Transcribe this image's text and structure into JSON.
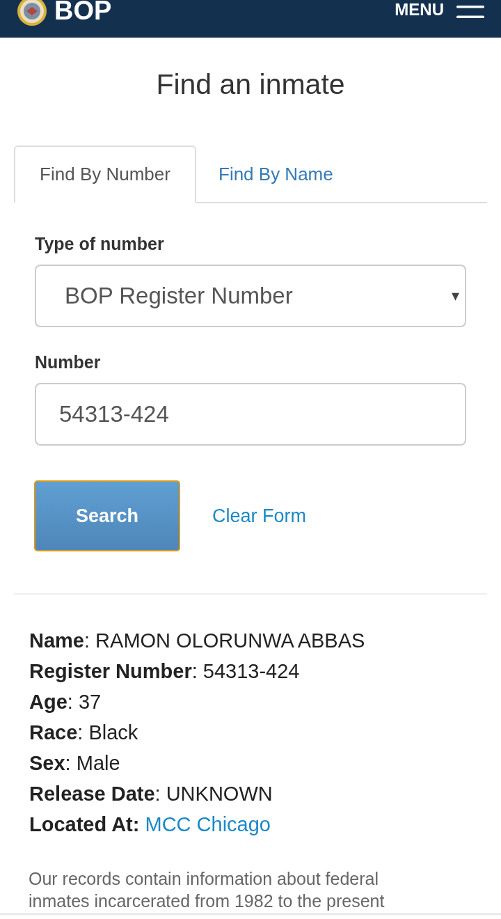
{
  "header": {
    "logo_text": "BOP",
    "menu_label": "MENU"
  },
  "page_title": "Find an inmate",
  "tabs": [
    {
      "label": "Find By Number",
      "selected": true
    },
    {
      "label": "Find By Name",
      "selected": false
    }
  ],
  "form": {
    "fields": [
      {
        "kind": "select",
        "label": "Type of number",
        "value": "BOP Register Number",
        "caret": "▾"
      },
      {
        "kind": "text",
        "label": "Number",
        "value": "54313-424"
      }
    ],
    "search_button": {
      "label": "Search",
      "focused": true
    },
    "clear_link": "Clear Form"
  },
  "result": [
    {
      "kind": "field",
      "text": "**Name**: RAMON OLORUNWA ABBAS"
    },
    {
      "kind": "field",
      "text": "**Register Number**: 54313-424"
    },
    {
      "kind": "field",
      "text": "**Age**: 37"
    },
    {
      "kind": "field",
      "text": "**Race**: Black"
    },
    {
      "kind": "field",
      "text": "**Sex**: Male"
    },
    {
      "kind": "field",
      "text": "**Release Date**: UNKNOWN"
    },
    {
      "kind": "link",
      "label": "Located At:",
      "link": "MCC Chicago"
    }
  ],
  "note": "Our records contain information about federal inmates incarcerated from 1982 to the present"
}
